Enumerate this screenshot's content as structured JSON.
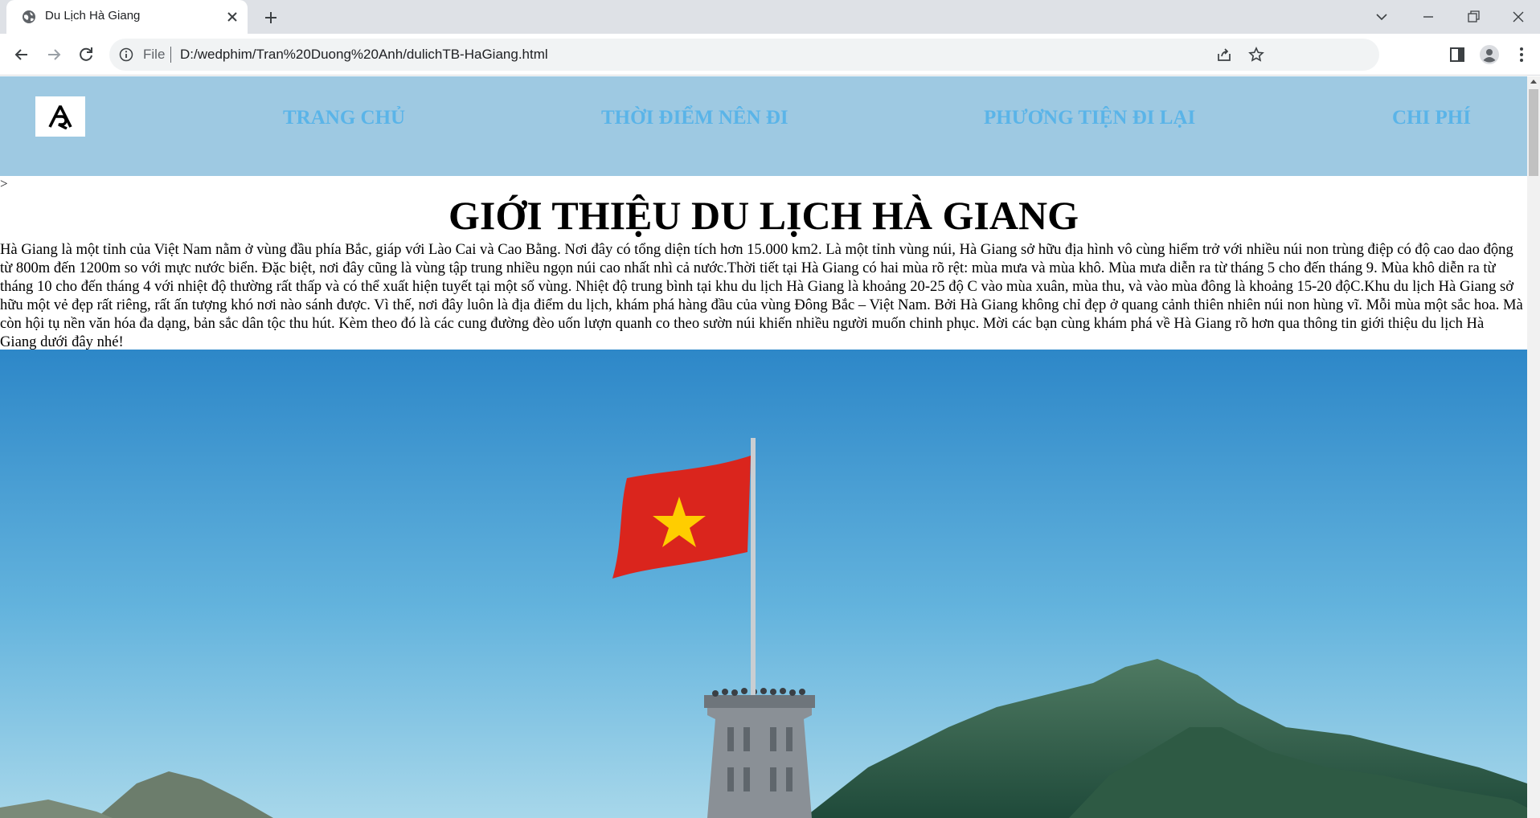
{
  "browser": {
    "tab_title": "Du Lịch Hà Giang",
    "url_scheme": "File",
    "url": "D:/wedphim/Tran%20Duong%20Anh/dulichTB-HaGiang.html"
  },
  "site": {
    "nav": [
      {
        "label": "TRANG CHỦ"
      },
      {
        "label": "THỜI ĐIỂM NÊN ĐI"
      },
      {
        "label": "PHƯƠNG TIỆN ĐI LẠI"
      },
      {
        "label": "CHI PHÍ"
      }
    ],
    "stray_text": ">",
    "headline": "GIỚI THIỆU DU LỊCH HÀ GIANG",
    "intro": "Hà Giang là một tỉnh của Việt Nam nằm ở vùng đầu phía Bắc, giáp với Lào Cai và Cao Bằng. Nơi đây có tổng diện tích hơn 15.000 km2. Là một tỉnh vùng núi, Hà Giang sở hữu địa hình vô cùng hiểm trở với nhiều núi non trùng điệp có độ cao dao động từ 800m đến 1200m so với mực nước biển. Đặc biệt, nơi đây cũng là vùng tập trung nhiều ngọn núi cao nhất nhì cả nước.Thời tiết tại Hà Giang có hai mùa rõ rệt: mùa mưa và mùa khô. Mùa mưa diễn ra từ tháng 5 cho đến tháng 9. Mùa khô diễn ra từ tháng 10 cho đến tháng 4 với nhiệt độ thường rất thấp và có thể xuất hiện tuyết tại một số vùng. Nhiệt độ trung bình tại khu du lịch Hà Giang là khoảng 20-25 độ C vào mùa xuân, mùa thu, và vào mùa đông là khoảng 15-20 độC.Khu du lịch Hà Giang sở hữu một vẻ đẹp rất riêng, rất ấn tượng khó nơi nào sánh được. Vì thế, nơi đây luôn là địa điểm du lịch, khám phá hàng đầu của vùng Đông Bắc – Việt Nam. Bởi Hà Giang không chỉ đẹp ở quang cảnh thiên nhiên núi non hùng vĩ. Mỗi mùa một sắc hoa. Mà còn hội tụ nền văn hóa đa dạng, bản sắc dân tộc thu hút. Kèm theo đó là các cung đường đèo uốn lượn quanh co theo sườn núi khiến nhiều người muốn chinh phục. Mời các bạn cùng khám phá về Hà Giang rõ hơn qua thông tin giới thiệu du lịch Hà Giang dưới đây nhé!"
  },
  "icons": {
    "favicon": "globe-icon",
    "tab_close": "close-icon",
    "new_tab": "plus-icon",
    "back": "arrow-left-icon",
    "forward": "arrow-right-icon",
    "reload": "reload-icon",
    "site_info": "info-icon",
    "share": "share-icon",
    "bookmark": "star-icon",
    "side_panel": "side-panel-icon",
    "profile": "avatar-icon",
    "menu": "kebab-menu-icon",
    "tab_search": "chevron-down-icon",
    "minimize": "minimize-icon",
    "restore": "restore-icon",
    "close_window": "close-icon"
  },
  "colors": {
    "header_bg": "#9ec9e2",
    "nav_text": "#5ab4e8",
    "tabstrip": "#dee1e6",
    "flag_red": "#da251d",
    "flag_star": "#ffcd00"
  }
}
